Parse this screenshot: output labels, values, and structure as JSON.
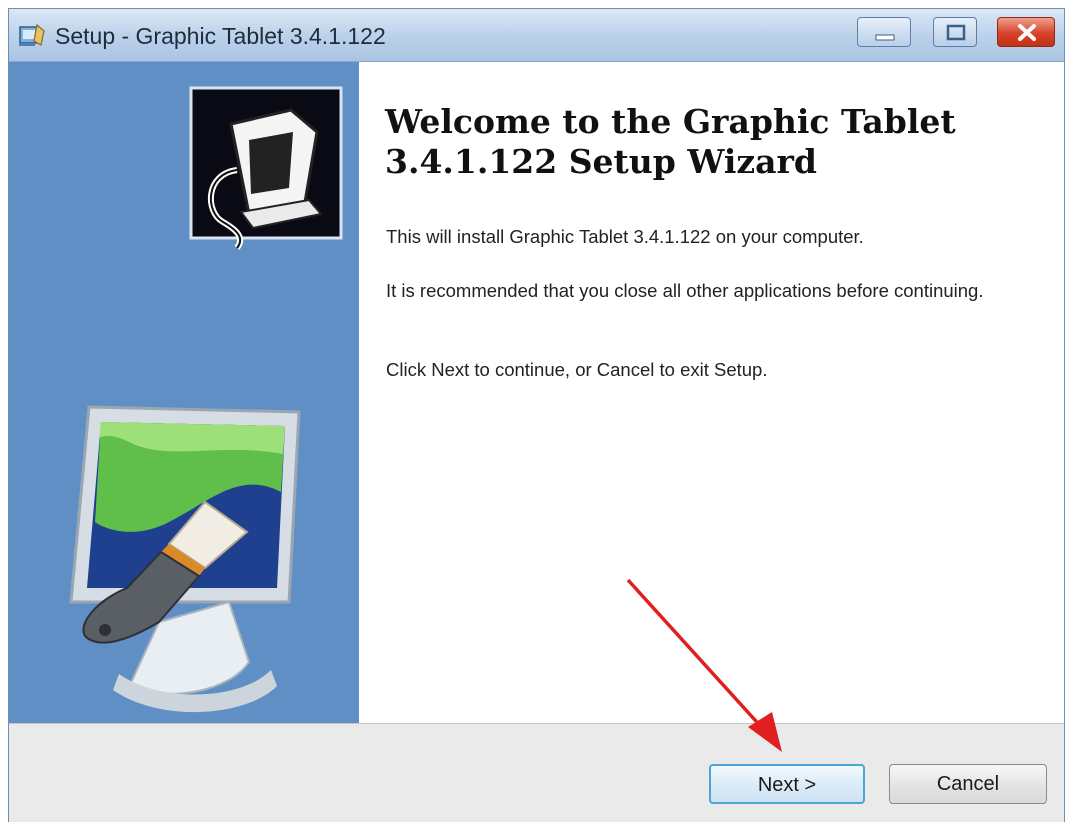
{
  "window": {
    "title": "Setup - Graphic Tablet 3.4.1.122"
  },
  "content": {
    "heading": "Welcome to the Graphic Tablet 3.4.1.122 Setup Wizard",
    "paragraphs": [
      "This will install Graphic Tablet 3.4.1.122 on your computer.",
      "It is recommended that you close all other applications before continuing.",
      "Click Next to continue, or Cancel to exit Setup."
    ]
  },
  "buttons": {
    "next_label": "Next >",
    "cancel_label": "Cancel"
  },
  "icons": {
    "title_icon": "setup-installer-icon",
    "wizard_logo": "computer-install-icon",
    "side_illustration": "monitor-paintbrush-illustration",
    "annotation": "red-arrow-annotation"
  },
  "colors": {
    "side_panel": "#5f8fc4",
    "annotation_arrow": "#e02020"
  }
}
